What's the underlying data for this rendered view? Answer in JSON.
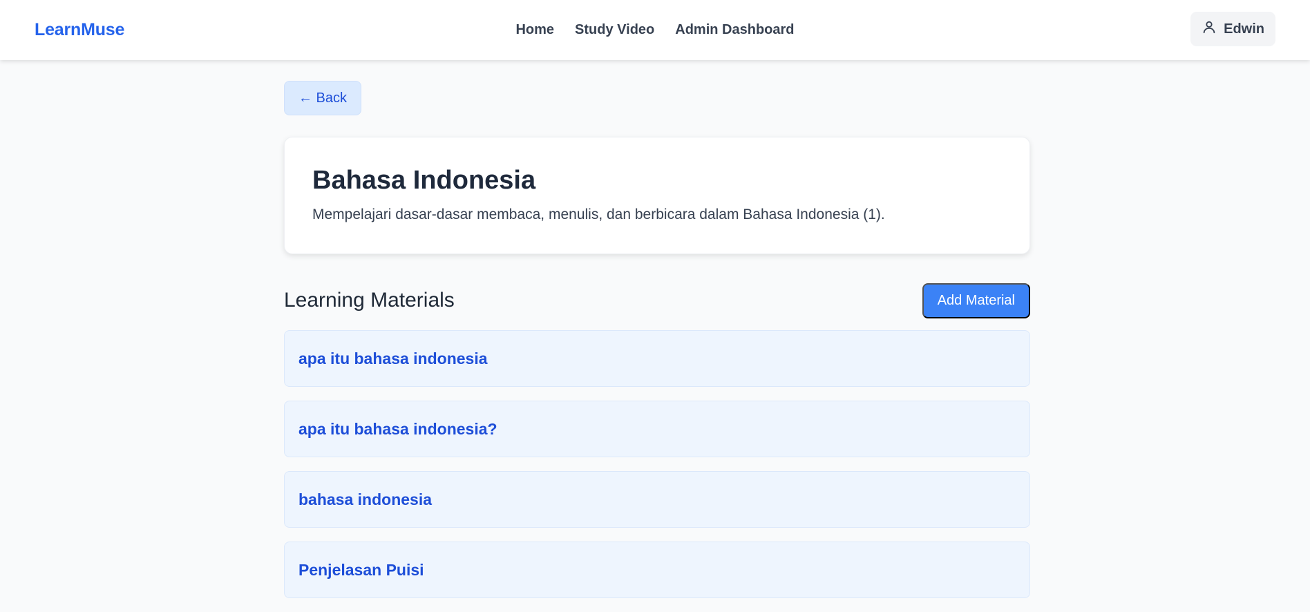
{
  "navbar": {
    "brand": "LearnMuse",
    "links": [
      {
        "label": "Home"
      },
      {
        "label": "Study Video"
      },
      {
        "label": "Admin Dashboard"
      }
    ],
    "user": {
      "name": "Edwin",
      "icon": "user-icon"
    }
  },
  "back_button": {
    "label": "← Back"
  },
  "course": {
    "title": "Bahasa Indonesia",
    "description": "Mempelajari dasar-dasar membaca, menulis, dan berbicara dalam Bahasa Indonesia (1)."
  },
  "materials_section": {
    "title": "Learning Materials",
    "add_label": "Add Material",
    "items": [
      {
        "title": "apa itu bahasa indonesia"
      },
      {
        "title": "apa itu bahasa indonesia?"
      },
      {
        "title": "bahasa indonesia"
      },
      {
        "title": "Penjelasan Puisi"
      }
    ]
  },
  "colors": {
    "brand": "#2563eb",
    "primary_button": "#3b82f6",
    "material_bg": "#eef5fe",
    "material_text": "#1d4ed8",
    "back_button_bg": "#dbeafe"
  }
}
